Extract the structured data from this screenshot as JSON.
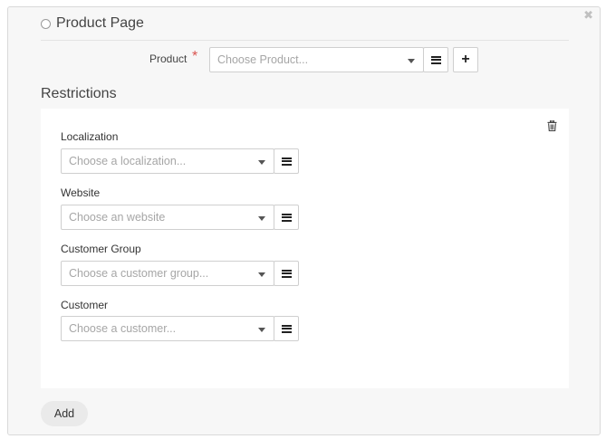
{
  "header": {
    "title": "Product Page",
    "close_glyph": "✖"
  },
  "product": {
    "label": "Product",
    "required_mark": "*",
    "placeholder": "Choose Product...",
    "add_glyph": "+"
  },
  "restrictions": {
    "title": "Restrictions",
    "fields": [
      {
        "label": "Localization",
        "placeholder": "Choose a localization..."
      },
      {
        "label": "Website",
        "placeholder": "Choose an website"
      },
      {
        "label": "Customer Group",
        "placeholder": "Choose a customer group..."
      },
      {
        "label": "Customer",
        "placeholder": "Choose a customer..."
      }
    ]
  },
  "footer": {
    "add_label": "Add"
  },
  "icons": {
    "close": "close-icon",
    "trash": "trash-icon",
    "list": "list-icon",
    "plus": "plus-icon",
    "caret": "chevron-down-icon"
  }
}
